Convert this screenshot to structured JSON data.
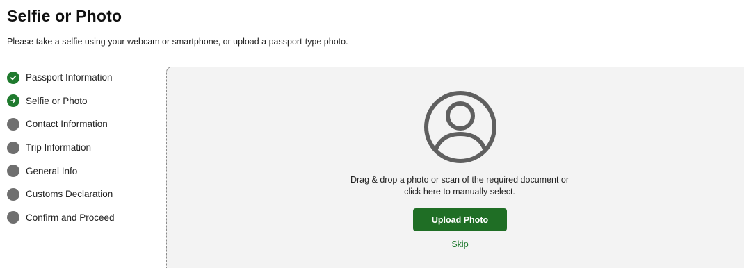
{
  "page": {
    "title": "Selfie or Photo",
    "subtitle": "Please take a selfie using your webcam or smartphone, or upload a passport-type photo."
  },
  "steps": [
    {
      "label": "Passport Information",
      "status": "done",
      "icon": "check-circle-icon"
    },
    {
      "label": "Selfie or Photo",
      "status": "current",
      "icon": "arrow-right-circle-icon"
    },
    {
      "label": "Contact Information",
      "status": "pending",
      "icon": "circle-icon"
    },
    {
      "label": "Trip Information",
      "status": "pending",
      "icon": "circle-icon"
    },
    {
      "label": "General Info",
      "status": "pending",
      "icon": "circle-icon"
    },
    {
      "label": "Customs Declaration",
      "status": "pending",
      "icon": "circle-icon"
    },
    {
      "label": "Confirm and Proceed",
      "status": "pending",
      "icon": "circle-icon"
    }
  ],
  "upload": {
    "icon": "user-avatar-icon",
    "instruction_line1": "Drag & drop a photo or scan of the required document or",
    "instruction_line2": "click here to manually select.",
    "button_label": "Upload Photo",
    "skip_label": "Skip"
  },
  "colors": {
    "accent": "#1f6e25",
    "done": "#1f7a2e",
    "pending": "#6f6f6f",
    "dropzone_bg": "#f3f3f3"
  }
}
